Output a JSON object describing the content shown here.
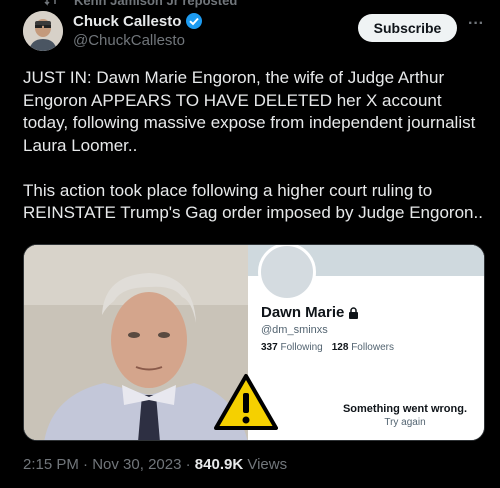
{
  "repost": {
    "text": "Kenn Jamison Jr reposted"
  },
  "author": {
    "name": "Chuck Callesto",
    "handle": "@ChuckCallesto"
  },
  "actions": {
    "subscribe_label": "Subscribe",
    "more_label": "···"
  },
  "tweet": {
    "text": "JUST IN: Dawn Marie Engoron, the wife of Judge Arthur Engoron APPEARS TO HAVE DELETED her X account today, following massive expose from independent journalist Laura Loomer..\n\nThis action took place following a higher court ruling to REINSTATE Trump's Gag order imposed by Judge Engoron.."
  },
  "media": {
    "profile": {
      "name": "Dawn Marie",
      "handle": "@dm_sminxs",
      "following_count": "337",
      "following_label": "Following",
      "followers_count": "128",
      "followers_label": "Followers",
      "error_title": "Something went wrong.",
      "error_action": "Try again"
    }
  },
  "meta": {
    "time": "2:15 PM",
    "date": "Nov 30, 2023",
    "separator": "·",
    "views_count": "840.9K",
    "views_label": "Views"
  },
  "colors": {
    "background": "#000000",
    "text": "#e7e9ea",
    "muted": "#71767b",
    "verified": "#1d9bf0",
    "warning": "#f5d000"
  }
}
